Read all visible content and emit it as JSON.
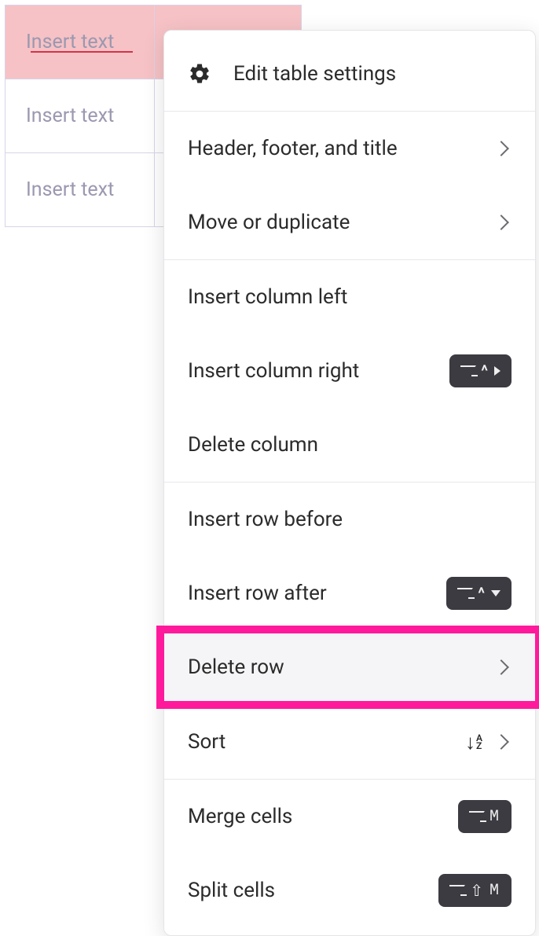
{
  "table": {
    "placeholder": "Insert text"
  },
  "menu": {
    "edit_settings": "Edit table settings",
    "header_footer_title": "Header, footer, and title",
    "move_or_duplicate": "Move or duplicate",
    "insert_col_left": "Insert column left",
    "insert_col_right": "Insert column right",
    "delete_column": "Delete column",
    "insert_row_before": "Insert row before",
    "insert_row_after": "Insert row after",
    "delete_row": "Delete row",
    "sort": "Sort",
    "merge_cells": "Merge cells",
    "split_cells": "Split cells"
  },
  "shortcuts": {
    "insert_col_right": {
      "keys": [
        "opt",
        "ctrl",
        "right"
      ]
    },
    "insert_row_after": {
      "keys": [
        "opt",
        "ctrl",
        "down"
      ]
    },
    "merge_cells": {
      "keys": [
        "opt",
        "M"
      ],
      "text": "M"
    },
    "split_cells": {
      "keys": [
        "opt",
        "shift",
        "M"
      ],
      "text": "M"
    }
  },
  "highlight": {
    "target": "delete_row"
  }
}
